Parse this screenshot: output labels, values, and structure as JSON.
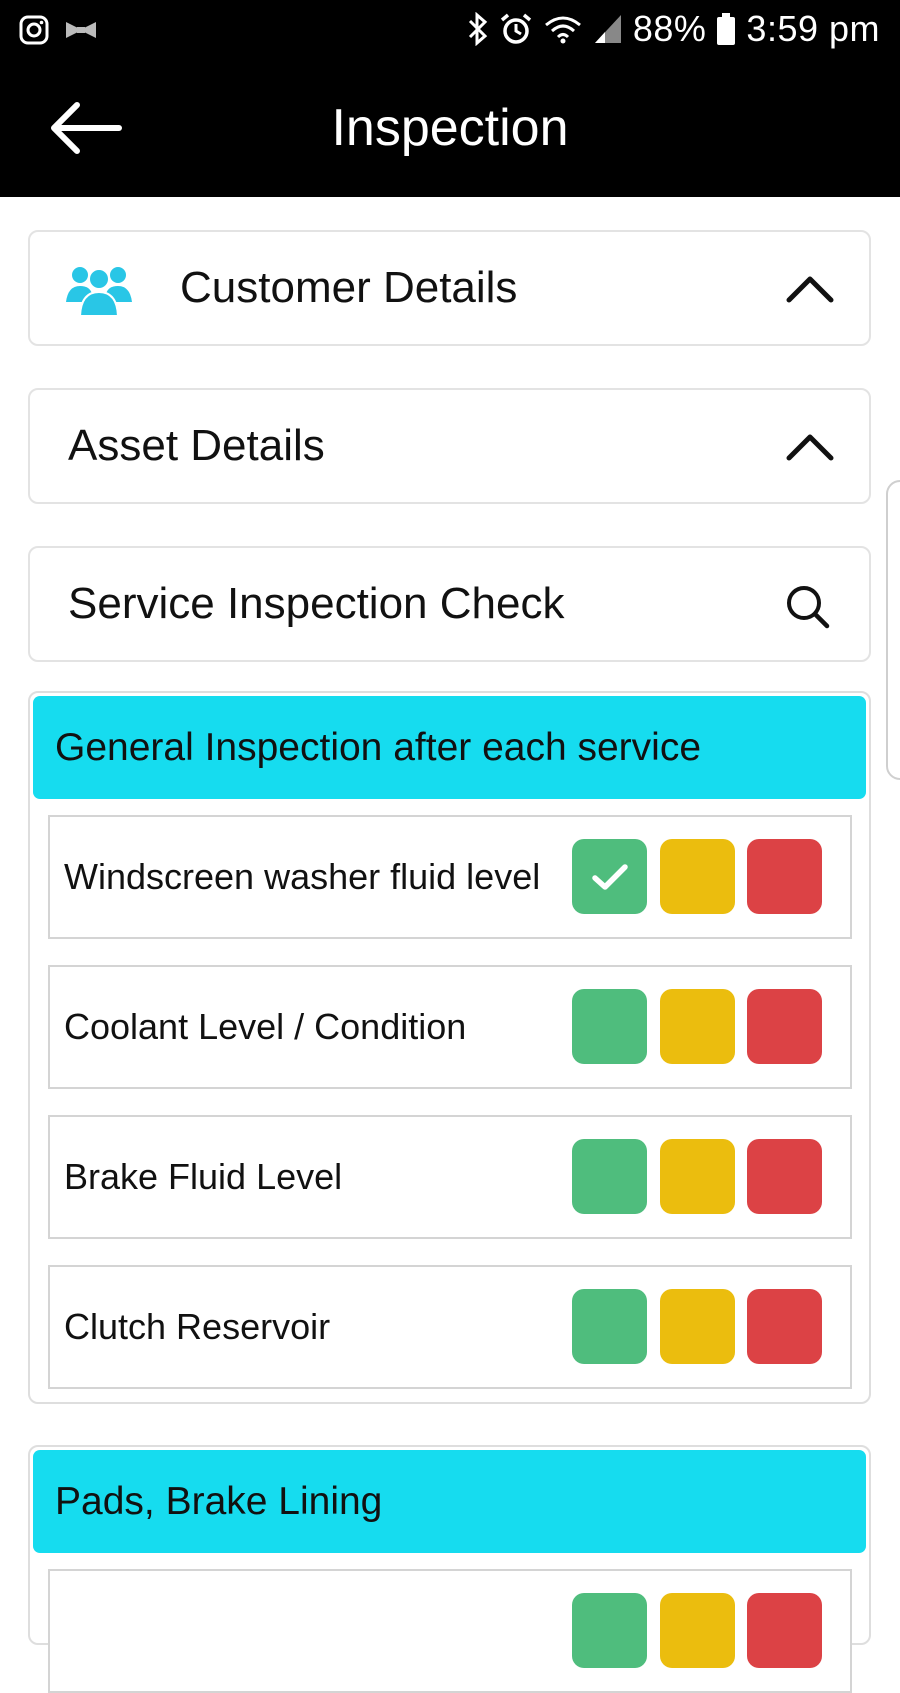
{
  "status_bar": {
    "left_icons": [
      "instagram-icon",
      "notification-icon"
    ],
    "right_icons": [
      "bluetooth-icon",
      "alarm-icon",
      "wifi-icon",
      "signal-icon"
    ],
    "battery": "88%",
    "time": "3:59 pm"
  },
  "app_bar": {
    "title": "Inspection",
    "back_icon": "back-arrow-icon"
  },
  "cards": {
    "customer": {
      "title": "Customer Details",
      "icon": "group-icon",
      "icon_color": "#29c6e6",
      "chevron": "chevron-up-icon"
    },
    "asset": {
      "title": "Asset Details",
      "chevron": "chevron-up-icon"
    },
    "service": {
      "title": "Service Inspection Check",
      "icon": "search-icon"
    }
  },
  "colors": {
    "section_header": "#16dcef",
    "green": "#4fbd7d",
    "amber": "#ebbd0e",
    "red": "#dc4245",
    "header_bg": "#000000"
  },
  "sections": [
    {
      "title": "General Inspection after each service",
      "items": [
        {
          "label": "Windscreen washer fluid level",
          "selected": "green"
        },
        {
          "label": "Coolant Level / Condition",
          "selected": null
        },
        {
          "label": "Brake Fluid Level",
          "selected": null
        },
        {
          "label": "Clutch Reservoir",
          "selected": null
        }
      ]
    },
    {
      "title": "Pads, Brake Lining",
      "items": []
    }
  ]
}
